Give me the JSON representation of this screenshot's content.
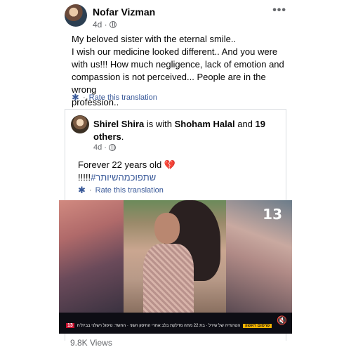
{
  "post": {
    "author": "Nofar Vizman",
    "time": "4d ·",
    "more": "•••",
    "lines": [
      "My beloved sister with the eternal smile..",
      "I wish our medicine looked different.. And you were",
      "with us!!! How much negligence, lack of emotion and",
      "compassion is not perceived... People are in the wrong",
      "profession.."
    ],
    "translate_sep": "·",
    "translate_label": "Rate this translation"
  },
  "shared": {
    "author": "Shirel Shira",
    "with_text": "is with",
    "tagged": "Shoham Halal",
    "and_text": "and",
    "others": "19 others",
    "period": ".",
    "time": "4d ·",
    "text_line1": "Forever 22 years old",
    "heart": "💔",
    "text_line2_prefix": "!!!!!",
    "hashtag": "#שתפוכמהשיותר",
    "translate_sep": "·",
    "translate_label": "Rate this translation"
  },
  "video": {
    "channel_logo": "13",
    "ticker_badge": "פרסום ראשון",
    "ticker_text": "הטרגדיה של שירל · בת 22 מתה מדלקת בלב אחרי החיסון השני · החשד: טיפול רשלני בבית\"ח",
    "ticker_num": "13",
    "speaker_icon": "🔇"
  },
  "footer": {
    "views": "9.8K Views"
  }
}
